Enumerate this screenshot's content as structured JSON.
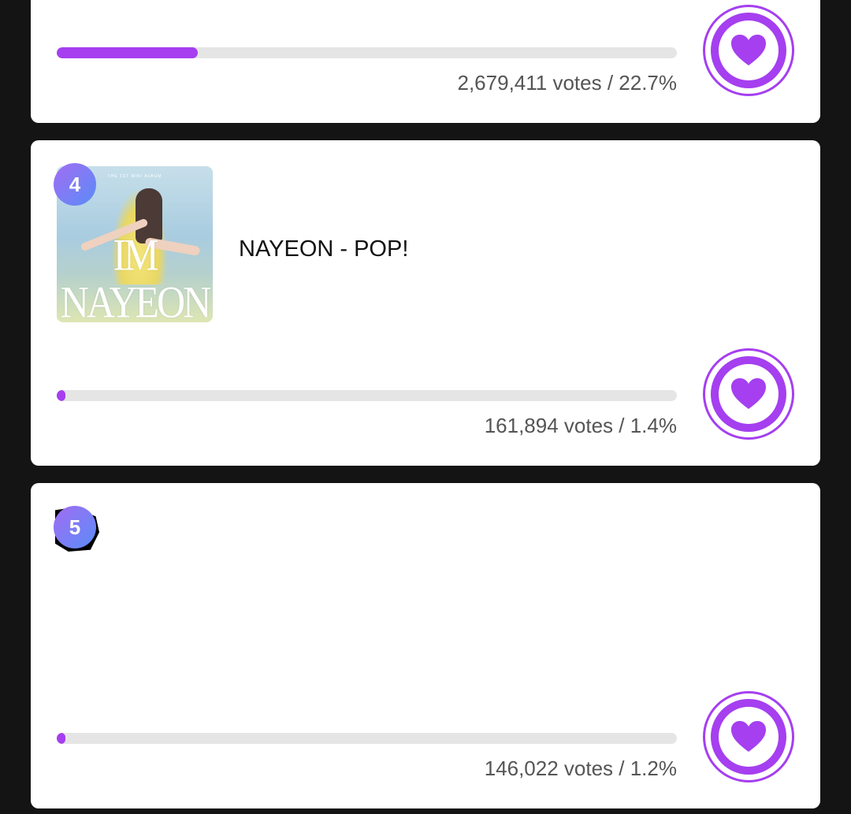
{
  "colors": {
    "accent": "#a53ff0",
    "background": "#141414",
    "card": "#ffffff",
    "track": "#e5e5e5",
    "badge_gradient": [
      "#a26cf3",
      "#5a8df7"
    ]
  },
  "entries": [
    {
      "votes_text": "2,679,411 votes / 22.7%",
      "percent": 22.7,
      "icon": "heart-icon"
    },
    {
      "rank": "4",
      "title": "NAYEON - POP!",
      "cover": {
        "subtitle": "THE 1ST MINI ALBUM",
        "logo": "IM NAYEON"
      },
      "votes_text": "161,894 votes / 1.4%",
      "percent": 1.4,
      "icon": "heart-icon"
    },
    {
      "rank": "5",
      "title": "",
      "votes_text": "146,022 votes / 1.2%",
      "percent": 1.2,
      "icon": "heart-icon"
    }
  ]
}
